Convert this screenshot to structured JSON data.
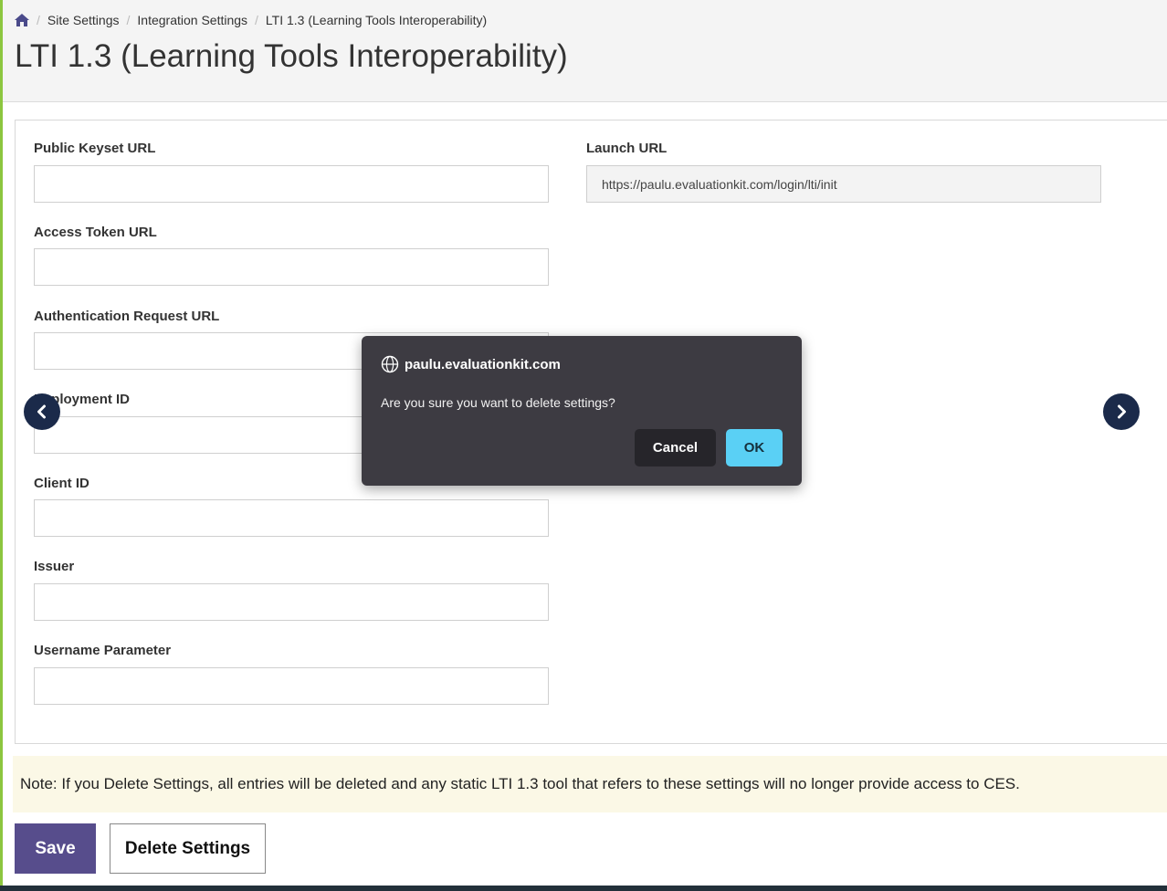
{
  "breadcrumb": {
    "home_icon": "home-icon",
    "items": [
      "Site Settings",
      "Integration Settings",
      "LTI 1.3 (Learning Tools Interoperability)"
    ]
  },
  "page": {
    "title": "LTI 1.3 (Learning Tools Interoperability)"
  },
  "form": {
    "public_keyset_url": {
      "label": "Public Keyset URL",
      "value": ""
    },
    "access_token_url": {
      "label": "Access Token URL",
      "value": ""
    },
    "auth_request_url": {
      "label": "Authentication Request URL",
      "value": ""
    },
    "deployment_id": {
      "label": "Deployment ID",
      "value": ""
    },
    "client_id": {
      "label": "Client ID",
      "value": ""
    },
    "issuer": {
      "label": "Issuer",
      "value": ""
    },
    "username_parameter": {
      "label": "Username Parameter",
      "value": ""
    },
    "launch_url": {
      "label": "Launch URL",
      "value": "https://paulu.evaluationkit.com/login/lti/init"
    }
  },
  "note": "Note: If you Delete Settings, all entries will be deleted and any static LTI 1.3 tool that refers to these settings will no longer provide access to CES.",
  "actions": {
    "save_label": "Save",
    "delete_label": "Delete Settings"
  },
  "dialog": {
    "origin": "paulu.evaluationkit.com",
    "message": "Are you sure you want to delete settings?",
    "cancel_label": "Cancel",
    "ok_label": "OK"
  },
  "colors": {
    "primary": "#574d8c",
    "nav": "#1b2a4a",
    "ok": "#5ad0f5",
    "accent_rule": "#8cc63f",
    "note_bg": "#fbf8e6"
  }
}
